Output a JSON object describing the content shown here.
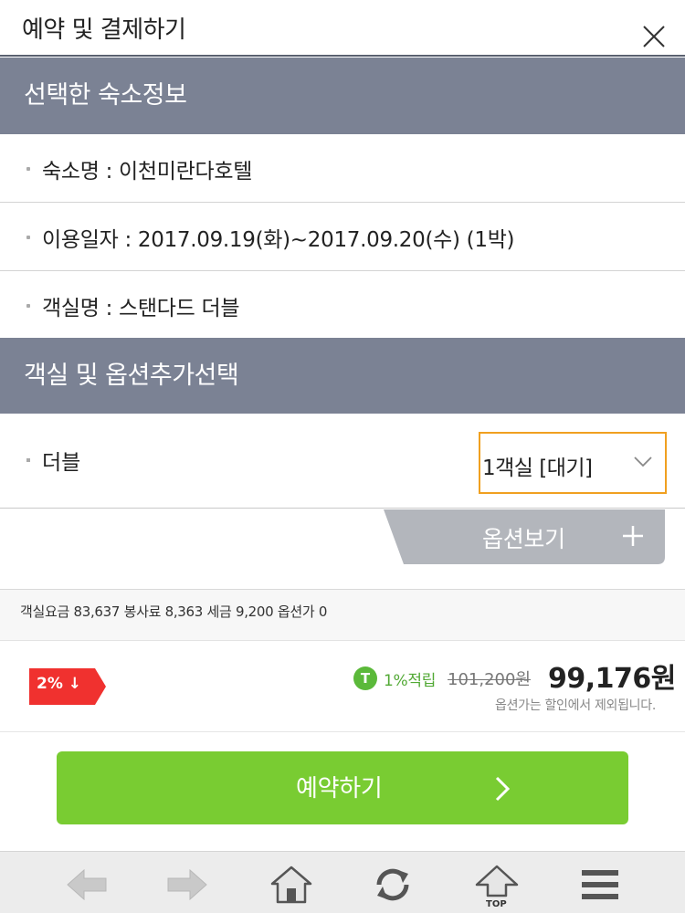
{
  "header": {
    "title": "예약 및 결제하기",
    "close_icon": "close-icon"
  },
  "sections": {
    "selected_info_title": "선택한 숙소정보",
    "room_option_title": "객실 및 옵션추가선택"
  },
  "info": {
    "hotel": "숙소명 : 이천미란다호텔",
    "dates": "이용일자 : 2017.09.19(화)~2017.09.20(수) (1박)",
    "room": "객실명 : 스탠다드 더블"
  },
  "room_select": {
    "room_type": "더블",
    "selected": "1객실 [대기]"
  },
  "options": {
    "label": "옵션보기"
  },
  "fees": {
    "line": "객실요금 83,637  봉사료 8,363  세금 9,200  옵션가 0"
  },
  "price": {
    "discount_label": "2% ↓",
    "point_badge": "T",
    "point_text": "1%적립",
    "original": "101,200원",
    "final": "99,176원",
    "note": "옵션가는 할인에서 제외됩니다."
  },
  "actions": {
    "reserve_label": "예약하기"
  },
  "bottom_nav": {
    "top_label": "TOP",
    "icons": [
      "back-icon",
      "forward-icon",
      "home-icon",
      "refresh-icon",
      "top-icon",
      "menu-icon"
    ]
  },
  "colors": {
    "section_bg": "#7b8294",
    "accent_green": "#79cc32",
    "discount_red": "#f0312f",
    "select_border": "#f0a020",
    "option_tab": "#b3b6bc"
  }
}
